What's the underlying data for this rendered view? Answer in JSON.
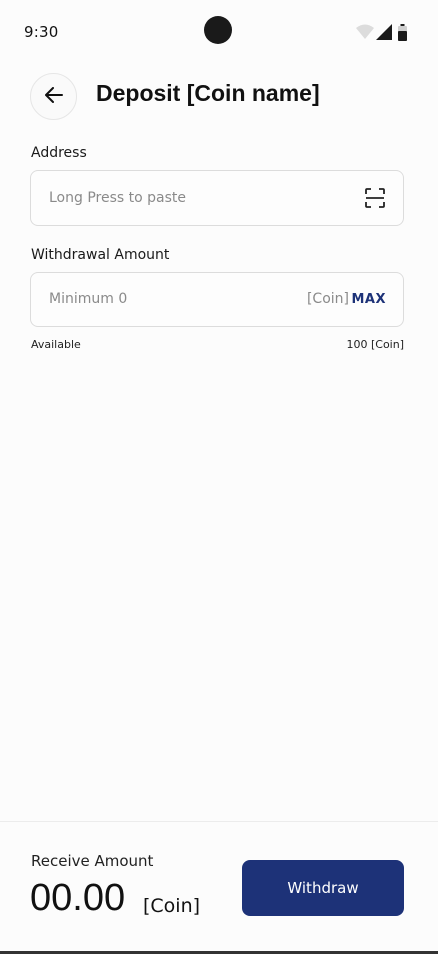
{
  "status_bar": {
    "time": "9:30",
    "icons": [
      "wifi-icon",
      "signal-icon",
      "battery-icon"
    ]
  },
  "header": {
    "back_icon": "arrow-left-icon",
    "title": "Deposit [Coin name]"
  },
  "address": {
    "label": "Address",
    "placeholder": "Long Press to paste",
    "icon": "scan-icon"
  },
  "withdrawal": {
    "label": "Withdrawal Amount",
    "placeholder": "Minimum 0",
    "unit": "[Coin]",
    "max_label": "MAX",
    "available_label": "Available",
    "available_value": "100 [Coin]"
  },
  "footer": {
    "receive_label": "Receive Amount",
    "receive_value": "00.00",
    "receive_unit": "[Coin]",
    "withdraw_label": "Withdraw"
  },
  "colors": {
    "primary": "#1d3278",
    "background": "#fcfcfc",
    "border": "#dcdcdc"
  }
}
